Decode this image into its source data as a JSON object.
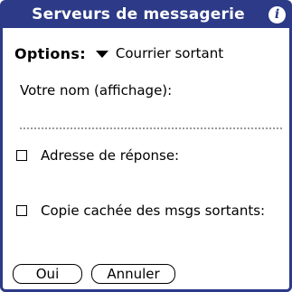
{
  "dialog": {
    "title": "Serveurs de messagerie",
    "info_icon": "info-icon",
    "border_color": "#2c3a87"
  },
  "options": {
    "label": "Options:",
    "selected": "Courrier sortant",
    "dropdown_icon": "triangle-down-icon"
  },
  "form": {
    "name_label": "Votre nom (affichage):",
    "name_value": "",
    "reply_label": "Adresse de réponse:",
    "reply_checked": false,
    "bcc_label": "Copie cachée des msgs sortants:",
    "bcc_checked": false
  },
  "buttons": {
    "ok": "Oui",
    "cancel": "Annuler"
  }
}
